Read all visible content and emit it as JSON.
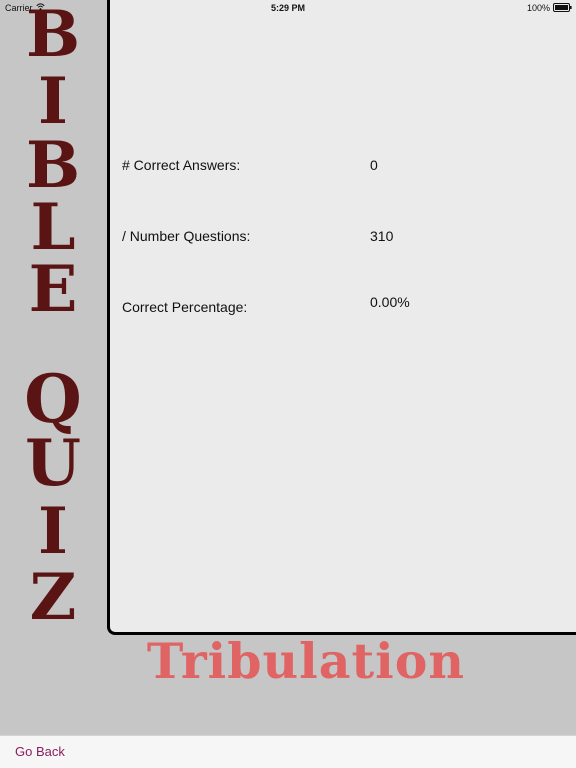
{
  "status_bar": {
    "carrier": "Carrier",
    "time": "5:29 PM",
    "battery": "100%",
    "wifi_icon": "wifi-icon",
    "battery_icon": "battery-icon"
  },
  "side_title": {
    "letters": [
      "B",
      "I",
      "B",
      "L",
      "E",
      "Q",
      "U",
      "I",
      "Z"
    ],
    "color": "#5b1414"
  },
  "subtitle": {
    "text": "Tribulation",
    "color": "#e06464"
  },
  "stats": {
    "correct_label": "# Correct Answers:",
    "correct_value": "0",
    "questions_label": "/ Number Questions:",
    "questions_value": "310",
    "percentage_label": "Correct Percentage:",
    "percentage_value": "0.00%"
  },
  "bottom_bar": {
    "go_back_label": "Go Back",
    "accent": "#8b1f5c"
  }
}
